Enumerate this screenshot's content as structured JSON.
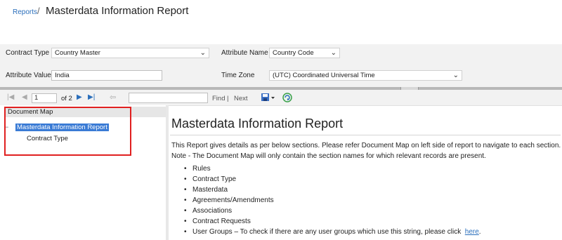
{
  "breadcrumb": {
    "reports_link": "Reports",
    "separator": "/",
    "title": "Masterdata Information Report"
  },
  "params": {
    "contract_type": {
      "label": "Contract Type",
      "value": "Country Master"
    },
    "attribute_name": {
      "label": "Attribute Name",
      "value": "Country Code"
    },
    "attribute_value": {
      "label": "Attribute Value",
      "value": "India"
    },
    "time_zone": {
      "label": "Time Zone",
      "value": "(UTC) Coordinated Universal Time"
    }
  },
  "toolbar": {
    "page_number": "1",
    "page_of": "of 2",
    "find_label": "Find",
    "separator": "|",
    "next_label": "Next",
    "find_value": ""
  },
  "doc_map": {
    "header": "Document Map",
    "toggle": "−",
    "root_item": "Masterdata Information Report",
    "child_item": "Contract Type"
  },
  "report": {
    "title": "Masterdata Information Report",
    "intro_line1": "This Report gives details as per below sections. Please refer Document Map on left side of report to navigate to each section.",
    "intro_line2": "Note - The Document Map will only contain the section names for which relevant records are present.",
    "sections": [
      "Rules",
      "Contract Type",
      "Masterdata",
      "Agreements/Amendments",
      "Associations",
      "Contract Requests"
    ],
    "user_groups_text": "User Groups – To check if there are any user groups which use this string, please click",
    "here_link": "here",
    "trailing": "."
  },
  "colors": {
    "accent": "#2a6ebb",
    "highlight": "#3a7bd5",
    "outline": "#e02020",
    "panel": "#f2f2f2"
  }
}
